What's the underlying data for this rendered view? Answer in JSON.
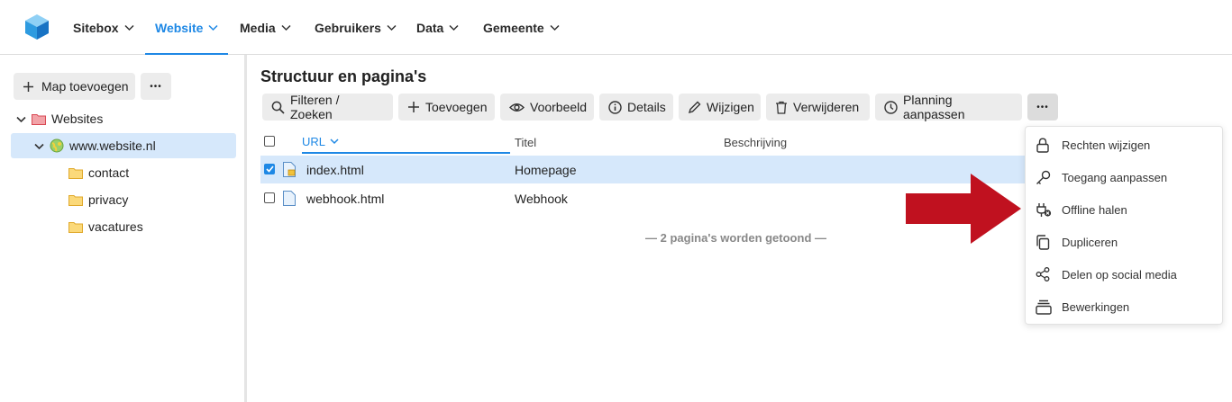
{
  "nav": {
    "logo": "sitebox-cube-logo",
    "items": [
      {
        "label": "Sitebox",
        "active": false
      },
      {
        "label": "Website",
        "active": true
      },
      {
        "label": "Media",
        "active": false
      },
      {
        "label": "Gebruikers",
        "active": false
      },
      {
        "label": "Data",
        "active": false
      },
      {
        "label": "Gemeente",
        "active": false
      }
    ],
    "accent_color": "#1e88e5"
  },
  "sidebar": {
    "add_folder_label": "Map toevoegen",
    "more_label": "•••",
    "tree": [
      {
        "label": "Websites",
        "icon": "red-folder-icon"
      },
      {
        "label": "www.website.nl",
        "icon": "globe-icon",
        "selected": true
      },
      {
        "label": "contact",
        "icon": "folder-icon"
      },
      {
        "label": "privacy",
        "icon": "folder-icon"
      },
      {
        "label": "vacatures",
        "icon": "folder-icon"
      }
    ]
  },
  "main": {
    "title": "Structuur en pagina's",
    "toolbar": {
      "filter": "Filteren / Zoeken",
      "add": "Toevoegen",
      "preview": "Voorbeeld",
      "details": "Details",
      "edit": "Wijzigen",
      "delete": "Verwijderen",
      "schedule": "Planning aanpassen",
      "more": "•••"
    },
    "table": {
      "columns": [
        "URL",
        "Titel",
        "Beschrijving"
      ],
      "rows": [
        {
          "url": "index.html",
          "title": "Homepage",
          "description": "",
          "checked": true
        },
        {
          "url": "webhook.html",
          "title": "Webhook",
          "description": "",
          "checked": false
        }
      ],
      "footer": "— 2 pagina's worden getoond —"
    }
  },
  "dropdown": {
    "items": [
      {
        "label": "Rechten wijzigen",
        "icon": "lock-icon"
      },
      {
        "label": "Toegang aanpassen",
        "icon": "key-icon"
      },
      {
        "label": "Offline halen",
        "icon": "plug-off-icon"
      },
      {
        "label": "Dupliceren",
        "icon": "copy-icon"
      },
      {
        "label": "Delen op social media",
        "icon": "share-icon"
      },
      {
        "label": "Bewerkingen",
        "icon": "stack-icon"
      }
    ]
  },
  "annotation": {
    "color": "#c0111f",
    "icon": "red-arrow-pointer"
  }
}
